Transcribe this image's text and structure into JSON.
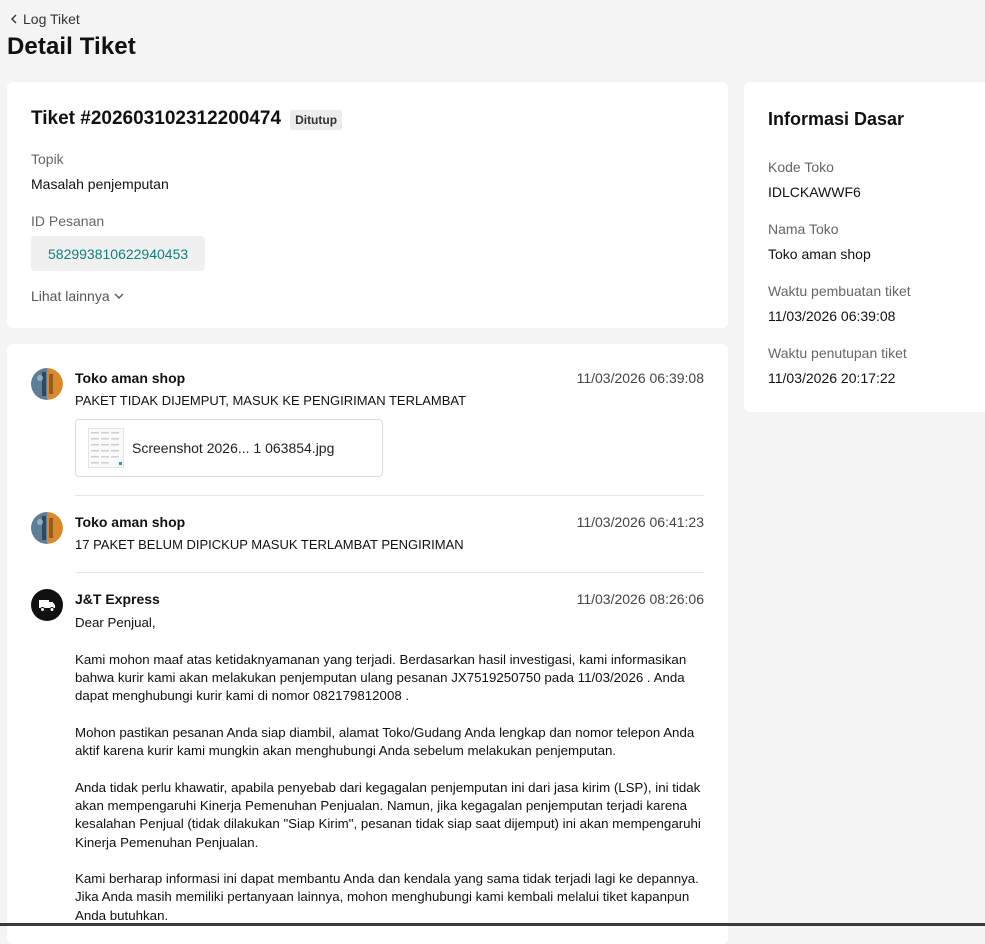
{
  "header": {
    "back_label": "Log Tiket",
    "page_title": "Detail Tiket"
  },
  "ticket": {
    "title": "Tiket #202603102312200474",
    "status": "Ditutup",
    "topic_label": "Topik",
    "topic_value": "Masalah penjemputan",
    "order_label": "ID Pesanan",
    "order_id": "582993810622940453",
    "see_more": "Lihat lainnya"
  },
  "info": {
    "title": "Informasi Dasar",
    "store_code_label": "Kode Toko",
    "store_code": "IDLCKAWWF6",
    "store_name_label": "Nama Toko",
    "store_name": "Toko aman shop",
    "created_label": "Waktu pembuatan tiket",
    "created": "11/03/2026 06:39:08",
    "closed_label": "Waktu penutupan tiket",
    "closed": "11/03/2026 20:17:22"
  },
  "messages": [
    {
      "sender": "Toko aman shop",
      "time": "11/03/2026 06:39:08",
      "text": "PAKET TIDAK DIJEMPUT, MASUK KE PENGIRIMAN TERLAMBAT",
      "attachment": "Screenshot 2026... 1 063854.jpg"
    },
    {
      "sender": "Toko aman shop",
      "time": "11/03/2026 06:41:23",
      "text": "17 PAKET BELUM DIPICKUP MASUK TERLAMBAT PENGIRIMAN"
    },
    {
      "sender": "J&T Express",
      "time": "11/03/2026 08:26:06",
      "paragraphs": [
        "Dear Penjual,",
        "Kami mohon maaf atas ketidaknyamanan yang terjadi. Berdasarkan hasil investigasi, kami informasikan bahwa kurir kami akan melakukan penjemputan ulang pesanan JX7519250750 pada 11/03/2026 . Anda dapat menghubungi kurir kami di nomor 082179812008 .",
        "Mohon pastikan pesanan Anda siap diambil, alamat Toko/Gudang Anda lengkap dan nomor telepon Anda aktif karena kurir kami mungkin akan menghubungi Anda sebelum melakukan penjemputan.",
        "Anda tidak perlu khawatir, apabila penyebab dari kegagalan penjemputan ini dari jasa kirim (LSP), ini tidak akan mempengaruhi Kinerja Pemenuhan Penjualan. Namun, jika kegagalan penjemputan terjadi karena kesalahan Penjual (tidak dilakukan \"Siap Kirim\", pesanan tidak siap saat dijemput) ini akan mempengaruhi Kinerja Pemenuhan Penjualan.",
        "Kami berharap informasi ini dapat membantu Anda dan kendala yang sama tidak terjadi lagi ke depannya. Jika Anda masih memiliki pertanyaan lainnya, mohon menghubungi kami kembali melalui tiket kapanpun Anda butuhkan."
      ]
    }
  ]
}
